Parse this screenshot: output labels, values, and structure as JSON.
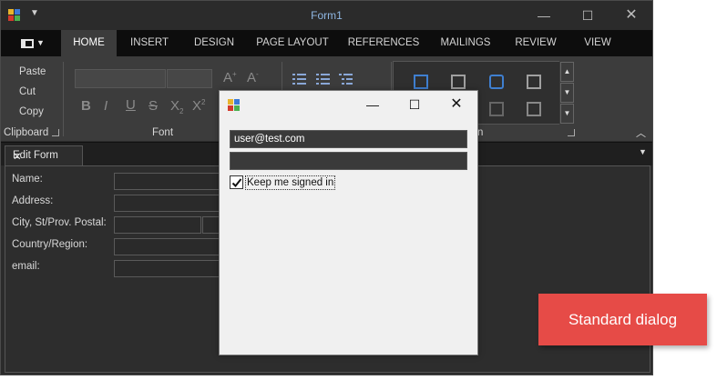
{
  "window": {
    "title": "Form1"
  },
  "ribbon": {
    "tabs": [
      "HOME",
      "INSERT",
      "DESIGN",
      "PAGE LAYOUT",
      "REFERENCES",
      "MAILINGS",
      "REVIEW",
      "VIEW"
    ],
    "active_tab": "HOME",
    "clipboard": {
      "paste": "Paste",
      "cut": "Cut",
      "copy": "Copy",
      "label": "Clipboard"
    },
    "font_group": {
      "label": "Font"
    },
    "styles_group": {
      "label_fragment": "n"
    }
  },
  "document": {
    "tab_label": "Edit Form",
    "fields": [
      {
        "label": "Name:"
      },
      {
        "label": "Address:"
      },
      {
        "label": "City, St/Prov. Postal:"
      },
      {
        "label": "Country/Region:"
      },
      {
        "label": "email:"
      }
    ]
  },
  "dialog": {
    "username": "user@test.com",
    "password": "",
    "remember_label": "Keep me signed in",
    "remember_checked": true
  },
  "callout": {
    "text": "Standard dialog"
  },
  "colors": {
    "accent_callout": "#e64b47",
    "title_text": "#8fb7e3"
  }
}
